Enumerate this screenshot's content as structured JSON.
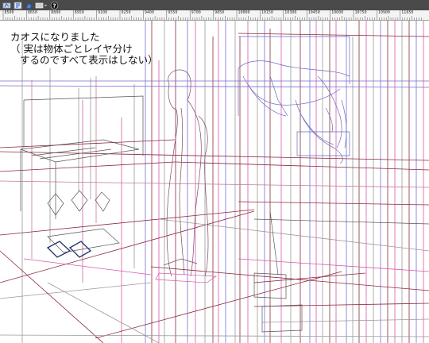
{
  "toolbar": {
    "tools": [
      {
        "name": "lasso-tool",
        "icon": "lasso-icon"
      },
      {
        "name": "layer-tool",
        "icon": "layer-icon"
      },
      {
        "name": "fill-tool",
        "icon": "fill-icon"
      },
      {
        "name": "display-menu",
        "icon": "monitor-icon"
      },
      {
        "name": "help-button",
        "icon": "question-icon"
      }
    ]
  },
  "ruler": {
    "labels": [
      "8500",
      "8650",
      "8800",
      "8950",
      "9100",
      "9250",
      "9400",
      "9550",
      "9700",
      "9850",
      "10000",
      "10150",
      "10300",
      "10450",
      "10600",
      "10750",
      "10900",
      "11050"
    ]
  },
  "annotation": {
    "line1": "カオスになりました",
    "line2": "（ 実は物体ごとレイヤ分け",
    "line3": "するのですべて表示はしない）"
  },
  "colors": {
    "toolbar_bg": "#4a4a4a",
    "ruler_bg": "#f4f4f4",
    "line_maroon": "#8b2a3a",
    "line_magenta": "#d65aa8",
    "line_violet": "#7a6ed2",
    "line_gray": "#9a9a9a"
  }
}
